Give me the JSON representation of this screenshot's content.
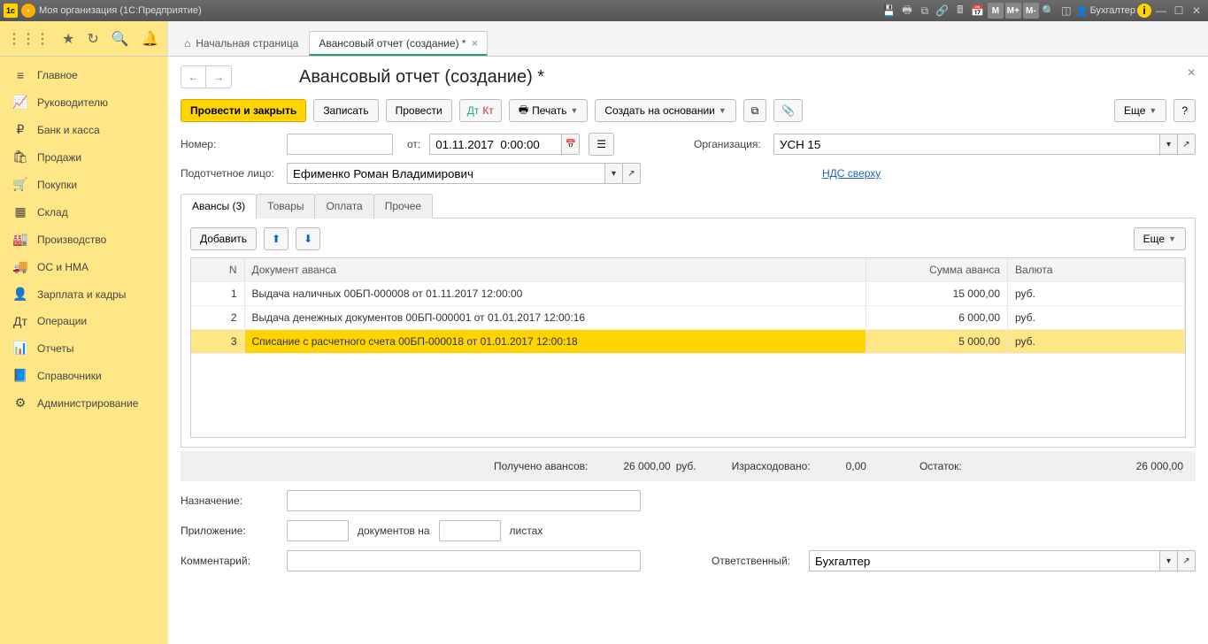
{
  "titlebar": {
    "app_title": "Моя организация  (1С:Предприятие)",
    "user": "Бухгалтер"
  },
  "tabs": {
    "home": "Начальная страница",
    "doc": "Авансовый отчет (создание) *"
  },
  "sidebar": {
    "items": [
      {
        "icon": "≡",
        "label": "Главное"
      },
      {
        "icon": "📈",
        "label": "Руководителю"
      },
      {
        "icon": "₽",
        "label": "Банк и касса"
      },
      {
        "icon": "🛍",
        "label": "Продажи"
      },
      {
        "icon": "🛒",
        "label": "Покупки"
      },
      {
        "icon": "▦",
        "label": "Склад"
      },
      {
        "icon": "🏭",
        "label": "Производство"
      },
      {
        "icon": "🚚",
        "label": "ОС и НМА"
      },
      {
        "icon": "👤",
        "label": "Зарплата и кадры"
      },
      {
        "icon": "Дт",
        "label": "Операции"
      },
      {
        "icon": "📊",
        "label": "Отчеты"
      },
      {
        "icon": "📘",
        "label": "Справочники"
      },
      {
        "icon": "⚙",
        "label": "Администрирование"
      }
    ]
  },
  "page": {
    "title": "Авансовый отчет (создание) *",
    "toolbar": {
      "post_close": "Провести и закрыть",
      "write": "Записать",
      "post": "Провести",
      "print": "Печать",
      "create_based": "Создать на основании",
      "more": "Еще"
    },
    "form": {
      "number_label": "Номер:",
      "number_value": "",
      "from_label": "от:",
      "date_value": "01.11.2017  0:00:00",
      "org_label": "Организация:",
      "org_value": "УСН 15",
      "person_label": "Подотчетное лицо:",
      "person_value": "Ефименко Роман Владимирович",
      "vat_link": "НДС сверху"
    },
    "subtabs": {
      "advances": "Авансы (3)",
      "goods": "Товары",
      "payment": "Оплата",
      "other": "Прочее"
    },
    "subactions": {
      "add": "Добавить",
      "more": "Еще"
    },
    "grid": {
      "headers": {
        "n": "N",
        "doc": "Документ аванса",
        "sum": "Сумма аванса",
        "cur": "Валюта"
      },
      "rows": [
        {
          "n": "1",
          "doc": "Выдача наличных 00БП-000008 от 01.11.2017 12:00:00",
          "sum": "15 000,00",
          "cur": "руб."
        },
        {
          "n": "2",
          "doc": "Выдача денежных документов 00БП-000001 от 01.01.2017 12:00:16",
          "sum": "6 000,00",
          "cur": "руб."
        },
        {
          "n": "3",
          "doc": "Списание с расчетного счета 00БП-000018 от 01.01.2017 12:00:18",
          "sum": "5 000,00",
          "cur": "руб."
        }
      ]
    },
    "totals": {
      "received_label": "Получено авансов:",
      "received_value": "26 000,00",
      "received_cur": "руб.",
      "spent_label": "Израсходовано:",
      "spent_value": "0,00",
      "balance_label": "Остаток:",
      "balance_value": "26 000,00"
    },
    "footer": {
      "purpose_label": "Назначение:",
      "attach_label": "Приложение:",
      "attach_docs": "документов на",
      "attach_sheets": "листах",
      "comment_label": "Комментарий:",
      "responsible_label": "Ответственный:",
      "responsible_value": "Бухгалтер"
    }
  }
}
